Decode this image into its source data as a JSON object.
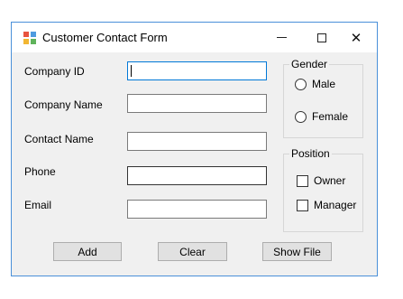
{
  "window": {
    "title": "Customer Contact Form"
  },
  "titlebar": {
    "min_icon": "minimize-icon",
    "max_icon": "maximize-icon",
    "close_glyph": "✕"
  },
  "form": {
    "company_id": {
      "label": "Company ID",
      "value": "",
      "placeholder": ""
    },
    "company_name": {
      "label": "Company Name",
      "value": "",
      "placeholder": ""
    },
    "contact_name": {
      "label": "Contact Name",
      "value": "",
      "placeholder": ""
    },
    "phone": {
      "label": "Phone",
      "value": "",
      "placeholder": ""
    },
    "email": {
      "label": "Email",
      "value": "",
      "placeholder": ""
    }
  },
  "gender": {
    "title": "Gender",
    "options": [
      "Male",
      "Female"
    ],
    "selected": null
  },
  "position": {
    "title": "Position",
    "options": [
      "Owner",
      "Manager"
    ],
    "checked": []
  },
  "buttons": {
    "add": "Add",
    "clear": "Clear",
    "show_file": "Show File"
  },
  "colors": {
    "accent": "#0078d7",
    "window_border": "#4a90d9",
    "form_bg": "#f0f0f0"
  }
}
